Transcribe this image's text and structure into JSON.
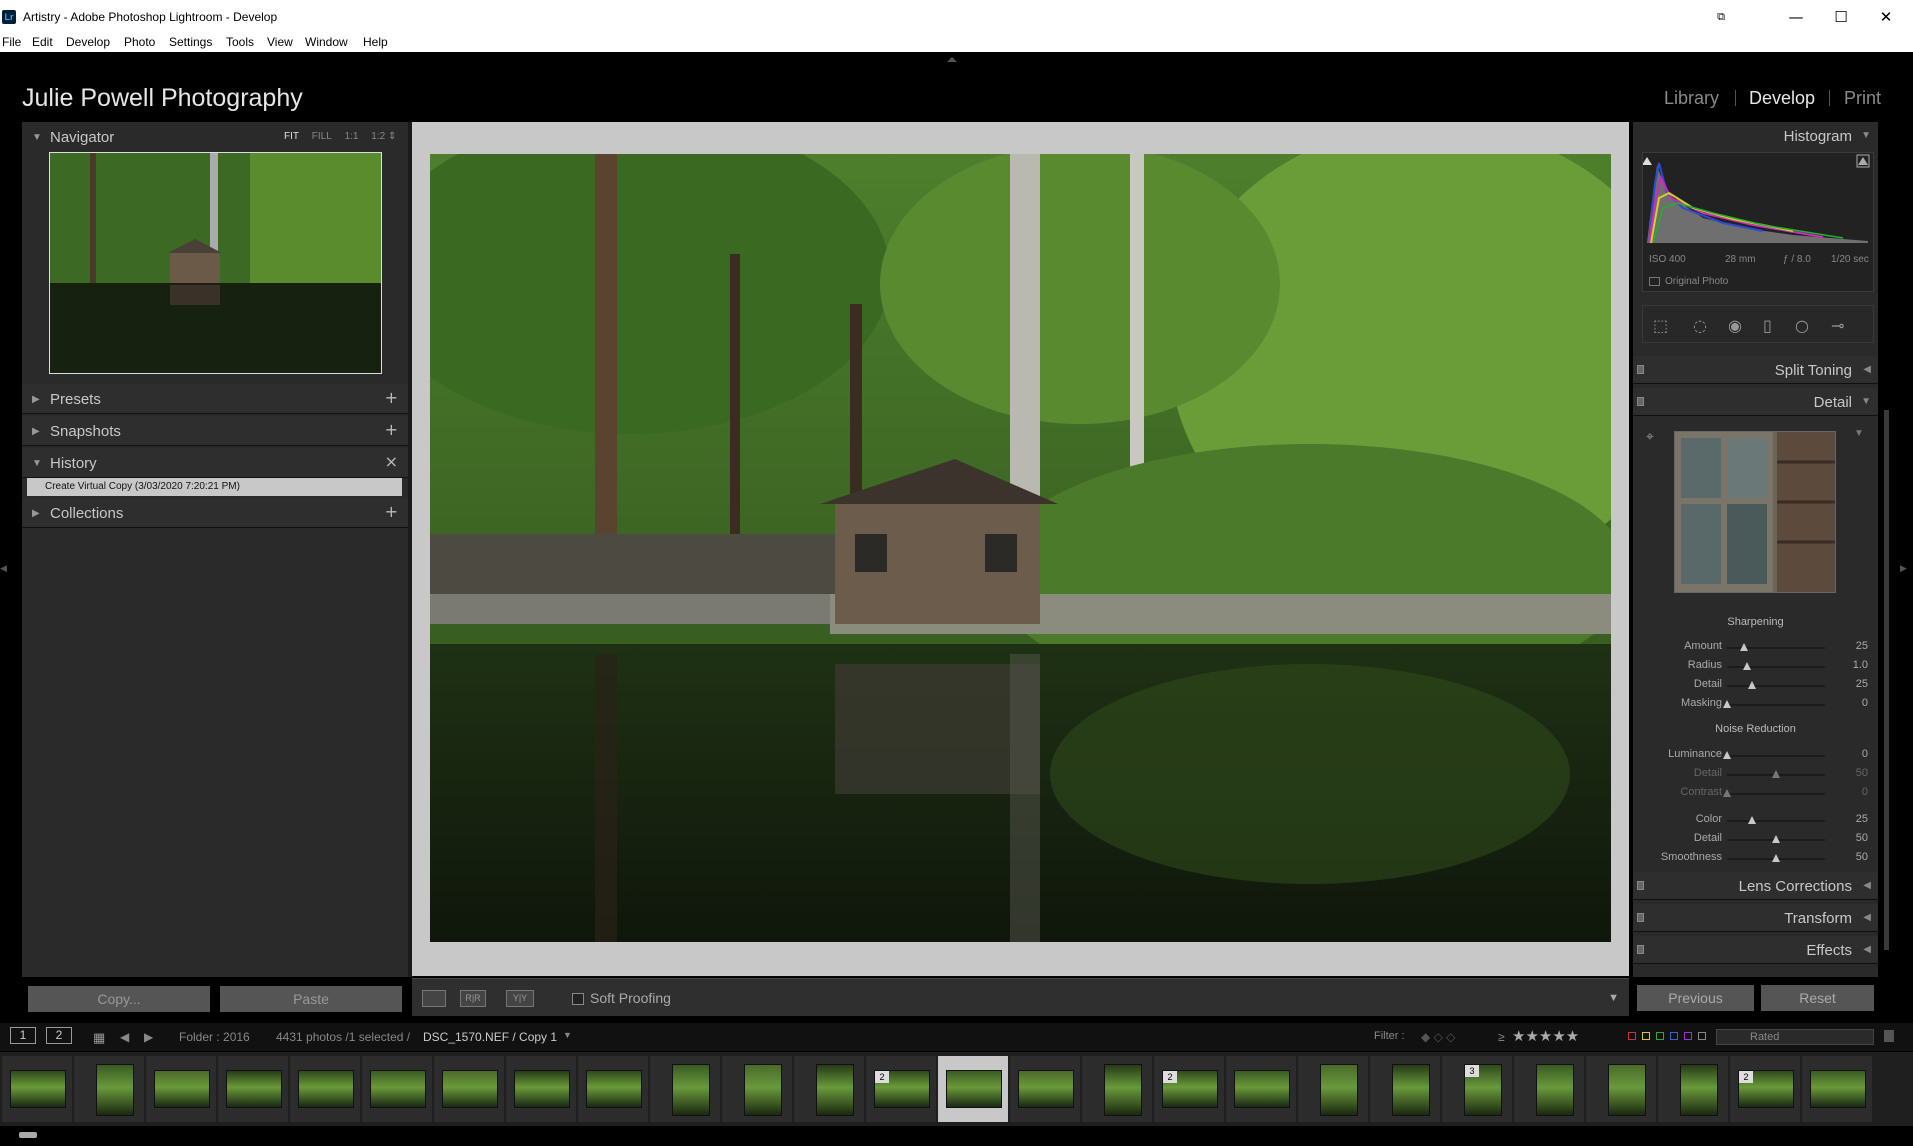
{
  "window": {
    "title": "Artistry - Adobe Photoshop Lightroom - Develop",
    "app_icon": "Lr",
    "controls": [
      "⧉",
      "—",
      "☐",
      "✕"
    ]
  },
  "menu": [
    "File",
    "Edit",
    "Develop",
    "Photo",
    "Settings",
    "Tools",
    "View",
    "Window",
    "Help"
  ],
  "header": {
    "identity_plate": "Julie Powell Photography",
    "modules": [
      "Library",
      "Develop",
      "Print"
    ],
    "active_module": "Develop"
  },
  "left_panel": {
    "navigator": {
      "label": "Navigator",
      "zoom": [
        "FIT",
        "FILL",
        "1:1",
        "1:2 ⇕"
      ]
    },
    "presets": {
      "label": "Presets",
      "action": "+"
    },
    "snapshots": {
      "label": "Snapshots",
      "action": "+"
    },
    "history": {
      "label": "History",
      "action": "×",
      "items": [
        "Create Virtual Copy (3/03/2020 7:20:21 PM)"
      ]
    },
    "collections": {
      "label": "Collections",
      "action": "+"
    },
    "copy_button": "Copy...",
    "paste_button": "Paste"
  },
  "toolbar": {
    "view_loupe": "",
    "view_compare": "R|R",
    "view_survey": "Y|Y",
    "soft_proofing_label": "Soft Proofing",
    "soft_proofing_checked": false,
    "dropdown": "▼"
  },
  "right_panel": {
    "histogram": {
      "label": "Histogram",
      "iso": "ISO 400",
      "focal": "28 mm",
      "aperture": "ƒ / 8.0",
      "shutter": "1/20 sec",
      "original_photo_label": "Original Photo"
    },
    "split_toning": {
      "label": "Split Toning"
    },
    "detail": {
      "label": "Detail",
      "sharpening_title": "Sharpening",
      "sharpening": [
        {
          "label": "Amount",
          "value": "25",
          "level": 0.17
        },
        {
          "label": "Radius",
          "value": "1.0",
          "level": 0.2
        },
        {
          "label": "Detail",
          "value": "25",
          "level": 0.25
        },
        {
          "label": "Masking",
          "value": "0",
          "level": 0.0
        }
      ],
      "noise_title": "Noise Reduction",
      "noise_luminance": [
        {
          "label": "Luminance",
          "value": "0",
          "level": 0.0,
          "dim": false
        },
        {
          "label": "Detail",
          "value": "50",
          "level": 0.5,
          "dim": true
        },
        {
          "label": "Contrast",
          "value": "0",
          "level": 0.0,
          "dim": true
        }
      ],
      "noise_color": [
        {
          "label": "Color",
          "value": "25",
          "level": 0.25
        },
        {
          "label": "Detail",
          "value": "50",
          "level": 0.5
        },
        {
          "label": "Smoothness",
          "value": "50",
          "level": 0.5
        }
      ]
    },
    "lens_corrections": {
      "label": "Lens Corrections"
    },
    "transform": {
      "label": "Transform"
    },
    "effects": {
      "label": "Effects"
    },
    "previous_button": "Previous",
    "reset_button": "Reset"
  },
  "filmstrip_bar": {
    "screen1": "1",
    "screen2": "2",
    "folder": "Folder : 2016",
    "count": "4431 photos /1 selected /",
    "filename": "DSC_1570.NEF / Copy 1",
    "filter_label": "Filter :",
    "stars_prefix": "≥",
    "stars": "★★★★★",
    "rated": "Rated"
  },
  "filmstrip": {
    "thumbnails": [
      {
        "badge": "",
        "portrait": false
      },
      {
        "badge": "",
        "portrait": true
      },
      {
        "badge": "",
        "portrait": false
      },
      {
        "badge": "",
        "portrait": false
      },
      {
        "badge": "",
        "portrait": false
      },
      {
        "badge": "",
        "portrait": false
      },
      {
        "badge": "",
        "portrait": false
      },
      {
        "badge": "",
        "portrait": false
      },
      {
        "badge": "",
        "portrait": false
      },
      {
        "badge": "",
        "portrait": true
      },
      {
        "badge": "",
        "portrait": true
      },
      {
        "badge": "",
        "portrait": true
      },
      {
        "badge": "2",
        "portrait": false
      },
      {
        "badge": "",
        "portrait": false,
        "selected": true
      },
      {
        "badge": "",
        "portrait": false
      },
      {
        "badge": "",
        "portrait": true
      },
      {
        "badge": "2",
        "portrait": false
      },
      {
        "badge": "",
        "portrait": false
      },
      {
        "badge": "",
        "portrait": true
      },
      {
        "badge": "",
        "portrait": true
      },
      {
        "badge": "3",
        "portrait": true
      },
      {
        "badge": "",
        "portrait": true
      },
      {
        "badge": "",
        "portrait": true
      },
      {
        "badge": "",
        "portrait": true
      },
      {
        "badge": "2",
        "portrait": false
      },
      {
        "badge": "",
        "portrait": false
      }
    ]
  },
  "colors": {
    "panel_bg": "#2a2a2a",
    "canvas_bg": "#c8c8c8",
    "forest_dark": "#1c2a16",
    "forest_green": "#3f6b25",
    "water": "#15200f"
  }
}
